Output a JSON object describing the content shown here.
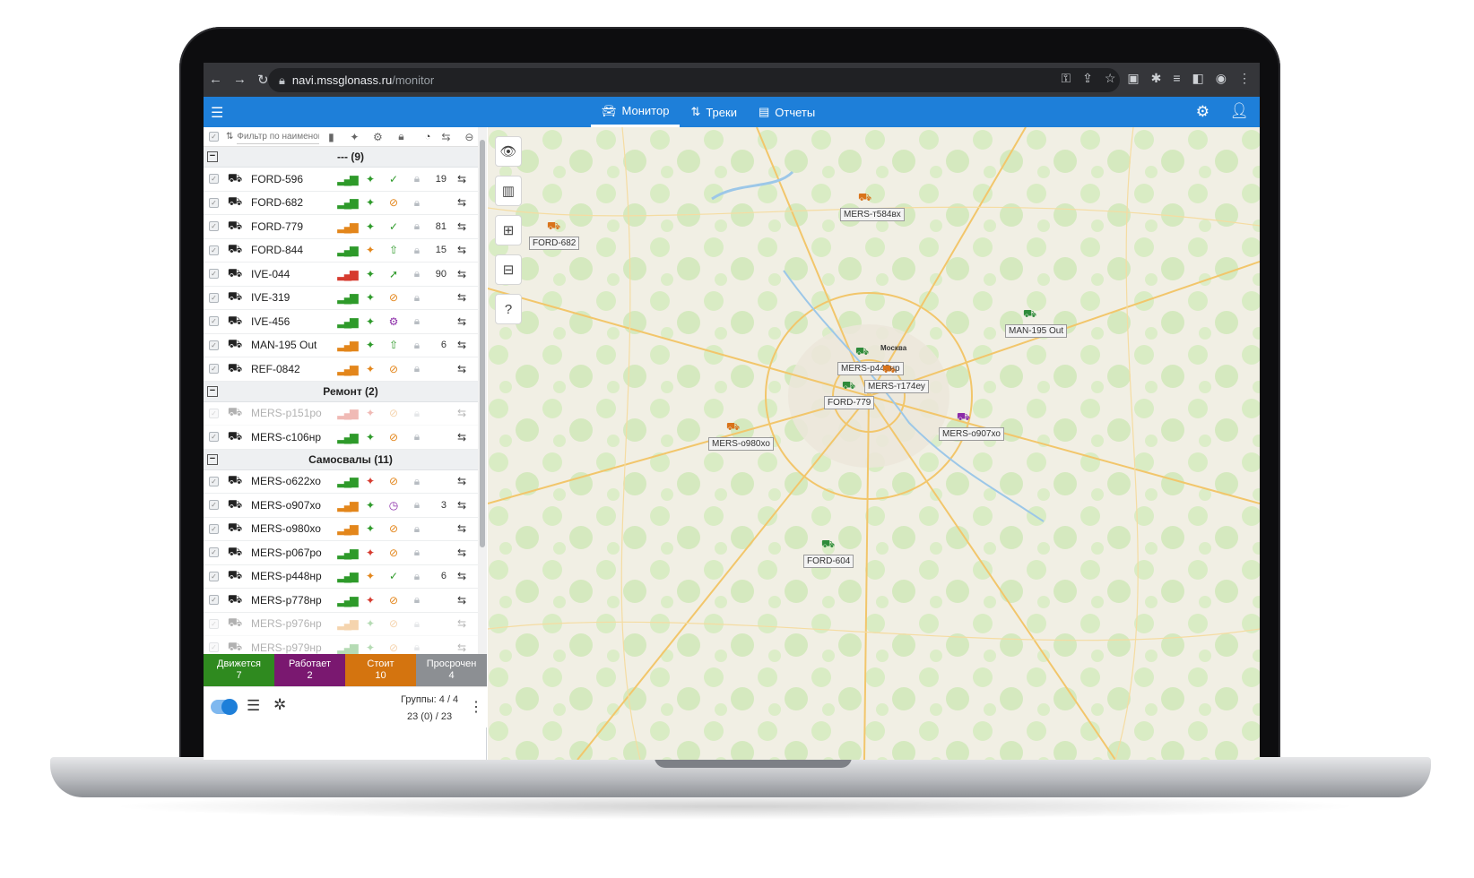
{
  "browser": {
    "url_host": "navi.mssglonass.ru",
    "url_path": "/monitor",
    "nav_icons": [
      "back-icon",
      "forward-icon",
      "reload-icon"
    ],
    "right_icons": [
      "key-icon",
      "share-icon",
      "star-icon",
      "extension-icon",
      "puzzle-icon",
      "queue-icon",
      "sidepanel-icon",
      "profile-icon",
      "menu-icon"
    ]
  },
  "appbar": {
    "tabs": [
      {
        "label": "Монитор",
        "icon": "car-monitor-icon",
        "active": true
      },
      {
        "label": "Треки",
        "icon": "tracks-icon",
        "active": false
      },
      {
        "label": "Отчеты",
        "icon": "reports-icon",
        "active": false
      }
    ]
  },
  "sidebar": {
    "filter_placeholder": "Фильтр по наименов",
    "groups": [
      {
        "label": "--- (9)",
        "vehicles": [
          {
            "name": "FORD-596",
            "signal": "g",
            "sat": "g",
            "state": "check",
            "state_color": "g",
            "num": "19",
            "dim": false
          },
          {
            "name": "FORD-682",
            "signal": "g",
            "sat": "g",
            "state": "off",
            "state_color": "o",
            "num": "",
            "dim": false
          },
          {
            "name": "FORD-779",
            "signal": "o",
            "sat": "g",
            "state": "check",
            "state_color": "g",
            "num": "81",
            "dim": false
          },
          {
            "name": "FORD-844",
            "signal": "g",
            "sat": "o",
            "state": "up",
            "state_color": "g",
            "num": "15",
            "dim": false
          },
          {
            "name": "IVE-044",
            "signal": "r",
            "sat": "g",
            "state": "arrow",
            "state_color": "g",
            "num": "90",
            "dim": false
          },
          {
            "name": "IVE-319",
            "signal": "g",
            "sat": "g",
            "state": "off",
            "state_color": "o",
            "num": "",
            "dim": false
          },
          {
            "name": "IVE-456",
            "signal": "g",
            "sat": "g",
            "state": "work",
            "state_color": "p",
            "num": "",
            "dim": false
          },
          {
            "name": "MAN-195 Out",
            "signal": "o",
            "sat": "g",
            "state": "up",
            "state_color": "g",
            "num": "6",
            "dim": false
          },
          {
            "name": "REF-0842",
            "signal": "o",
            "sat": "o",
            "state": "off",
            "state_color": "o",
            "num": "",
            "dim": false
          }
        ]
      },
      {
        "label": "Ремонт (2)",
        "vehicles": [
          {
            "name": "MERS-р151ро",
            "signal": "r",
            "sat": "r",
            "state": "off",
            "state_color": "o",
            "num": "",
            "dim": true
          },
          {
            "name": "MERS-с106нр",
            "signal": "g",
            "sat": "g",
            "state": "off",
            "state_color": "o",
            "num": "",
            "dim": false
          }
        ]
      },
      {
        "label": "Самосвалы (11)",
        "vehicles": [
          {
            "name": "MERS-о622хо",
            "signal": "g",
            "sat": "r",
            "state": "off",
            "state_color": "o",
            "num": "",
            "dim": false
          },
          {
            "name": "MERS-о907хо",
            "signal": "o",
            "sat": "g",
            "state": "clock",
            "state_color": "p",
            "num": "3",
            "dim": false
          },
          {
            "name": "MERS-о980хо",
            "signal": "o",
            "sat": "g",
            "state": "off",
            "state_color": "o",
            "num": "",
            "dim": false
          },
          {
            "name": "MERS-р067ро",
            "signal": "g",
            "sat": "r",
            "state": "off",
            "state_color": "o",
            "num": "",
            "dim": false
          },
          {
            "name": "MERS-р448нр",
            "signal": "g",
            "sat": "o",
            "state": "check",
            "state_color": "g",
            "num": "6",
            "dim": false
          },
          {
            "name": "MERS-р778нр",
            "signal": "g",
            "sat": "r",
            "state": "off",
            "state_color": "o",
            "num": "",
            "dim": false
          },
          {
            "name": "MERS-р976нр",
            "signal": "o",
            "sat": "g",
            "state": "off",
            "state_color": "o",
            "num": "",
            "dim": true
          },
          {
            "name": "MERS-р979нр",
            "signal": "g",
            "sat": "g",
            "state": "off",
            "state_color": "o",
            "num": "",
            "dim": true
          }
        ]
      }
    ],
    "status": [
      {
        "label": "Движется",
        "count": "7",
        "key": "moving"
      },
      {
        "label": "Работает",
        "count": "2",
        "key": "working"
      },
      {
        "label": "Стоит",
        "count": "10",
        "key": "standing"
      },
      {
        "label": "Просрочен",
        "count": "4",
        "key": "overdue"
      }
    ],
    "groups_summary": "Группы: 4 / 4",
    "objects_summary": "23 (0) / 23"
  },
  "map": {
    "tools": [
      "eye-icon",
      "map-layers-icon",
      "zoom-in-icon",
      "zoom-out-icon",
      "help-icon"
    ],
    "vehicles": [
      {
        "label": "MERS-т584вх",
        "color": "#d9731a"
      },
      {
        "label": "FORD-682",
        "color": "#d9731a"
      },
      {
        "label": "MAN-195 Out",
        "color": "#2e8b3a"
      },
      {
        "label": "MERS-р448нр",
        "color": "#2e8b3a"
      },
      {
        "label": "FORD-779",
        "color": "#2e8b3a"
      },
      {
        "label": "MERS-т174еу",
        "color": "#d9731a"
      },
      {
        "label": "MERS-о907хо",
        "color": "#8b2ba8"
      },
      {
        "label": "MERS-о980хо",
        "color": "#d9731a"
      },
      {
        "label": "FORD-604",
        "color": "#2e8b3a"
      }
    ],
    "city_label": "Москва"
  },
  "colors": {
    "accent": "#1e7fd9",
    "moving": "#2f8a1f",
    "working": "#7a1870",
    "standing": "#d4740f",
    "overdue": "#8c8f93"
  }
}
